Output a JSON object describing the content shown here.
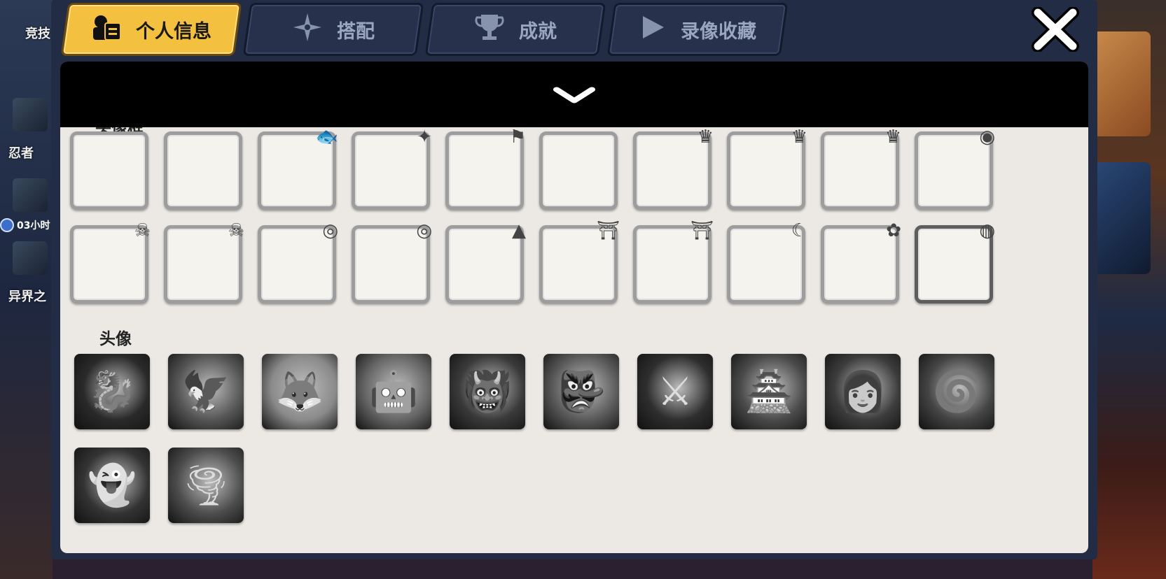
{
  "tabs": [
    {
      "label": "个人信息",
      "icon": "person-icon",
      "active": true
    },
    {
      "label": "搭配",
      "icon": "shuriken-icon",
      "active": false
    },
    {
      "label": "成就",
      "icon": "trophy-icon",
      "active": false
    },
    {
      "label": "录像收藏",
      "icon": "play-icon",
      "active": false
    }
  ],
  "close_icon": "close-icon",
  "collapse_icon": "chevron-down-icon",
  "sections": {
    "frames_label": "头像框",
    "avatars_label": "头像"
  },
  "background": {
    "left_labels": [
      "竞技",
      "忍者",
      "异界之"
    ],
    "timer": "03小时"
  },
  "frames": [
    {
      "decor": "none"
    },
    {
      "decor": "none"
    },
    {
      "decor": "fish"
    },
    {
      "decor": "shuriken-flags"
    },
    {
      "decor": "flag"
    },
    {
      "decor": "none"
    },
    {
      "decor": "crown"
    },
    {
      "decor": "crown-wings"
    },
    {
      "decor": "crown-wings"
    },
    {
      "decor": "eye-claw"
    },
    {
      "decor": "skull-claw"
    },
    {
      "decor": "skull"
    },
    {
      "decor": "tomoe-sign"
    },
    {
      "decor": "tomoe"
    },
    {
      "decor": "spikes"
    },
    {
      "decor": "pagoda"
    },
    {
      "decor": "pagoda"
    },
    {
      "decor": "moon-pagoda"
    },
    {
      "decor": "flower"
    },
    {
      "decor": "pumpkin-lollipop"
    }
  ],
  "avatars": [
    {
      "icon": "dragon-icon"
    },
    {
      "icon": "eagle-icon"
    },
    {
      "icon": "fox-mask-icon"
    },
    {
      "icon": "robot-icon"
    },
    {
      "icon": "shadow-beast-icon"
    },
    {
      "icon": "armored-demon-icon"
    },
    {
      "icon": "warrior-icon"
    },
    {
      "icon": "samurai-robot-icon"
    },
    {
      "icon": "ninja-girl-icon"
    },
    {
      "icon": "shadow-swirl-icon"
    },
    {
      "icon": "spirit-icon"
    },
    {
      "icon": "spirit-storm-icon"
    }
  ]
}
